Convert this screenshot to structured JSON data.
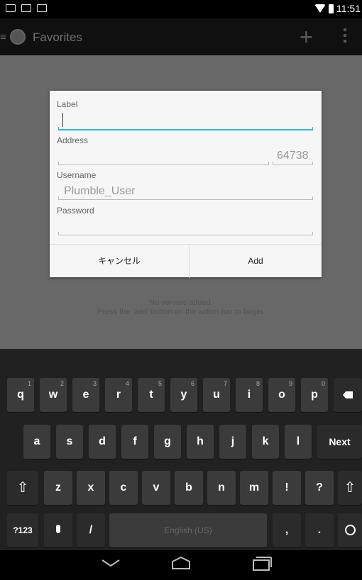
{
  "action_bar": {
    "title": "Favorites"
  },
  "status_bar": {
    "time": "11:51"
  },
  "dialog": {
    "label_label": "Label",
    "address_label": "Address",
    "port_value": "64738",
    "username_label": "Username",
    "username_value": "Plumble_User",
    "password_label": "Password",
    "cancel_label": "キャンセル",
    "add_label": "Add"
  },
  "empty_state": {
    "line1": "No servers added.",
    "line2": "Press the 'add' button on the action bar to begin."
  },
  "keyboard": {
    "row1": [
      {
        "key": "q",
        "hint": "1"
      },
      {
        "key": "w",
        "hint": "2"
      },
      {
        "key": "e",
        "hint": "3"
      },
      {
        "key": "r",
        "hint": "4"
      },
      {
        "key": "t",
        "hint": "5"
      },
      {
        "key": "y",
        "hint": "6"
      },
      {
        "key": "u",
        "hint": "7"
      },
      {
        "key": "i",
        "hint": "8"
      },
      {
        "key": "o",
        "hint": "9"
      },
      {
        "key": "p",
        "hint": "0"
      }
    ],
    "row2": [
      "a",
      "s",
      "d",
      "f",
      "g",
      "h",
      "j",
      "k",
      "l"
    ],
    "row3": [
      "z",
      "x",
      "c",
      "v",
      "b",
      "n",
      "m",
      "!",
      "?"
    ],
    "next_label": "Next",
    "symbols_label": "?123",
    "slash_label": "/",
    "space_label": "English (US)",
    "comma_label": ",",
    "period_label": "."
  },
  "icons": {
    "back": "back-icon",
    "home": "home-icon",
    "recents": "recents-icon",
    "add": "add-icon",
    "overflow": "overflow-icon"
  },
  "colors": {
    "accent": "#33b5e5"
  }
}
